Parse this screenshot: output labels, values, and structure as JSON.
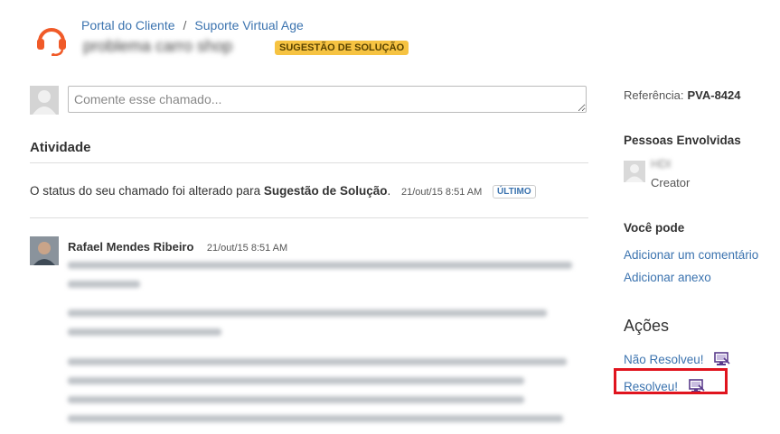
{
  "breadcrumb": {
    "items": [
      "Portal do Cliente",
      "Suporte Virtual Age"
    ],
    "separator": "/"
  },
  "ticket": {
    "title": "problema carro shop",
    "status_badge": "SUGESTÃO DE SOLUÇÃO"
  },
  "comment_box": {
    "placeholder": "Comente esse chamado..."
  },
  "activity": {
    "heading": "Atividade",
    "status_change": {
      "prefix": "O status do seu chamado foi alterado para",
      "status": "Sugestão de Solução",
      "suffix": ".",
      "date": "21/out/15 8:51 AM",
      "badge": "ÚLTIMO"
    },
    "comment": {
      "author": "Rafael Mendes Ribeiro",
      "date": "21/out/15 8:51 AM"
    }
  },
  "sidebar": {
    "reference_label": "Referência:",
    "reference_value": "PVA-8424",
    "people_heading": "Pessoas Envolvidas",
    "person_name": "HDI",
    "person_role": "Creator",
    "you_can_heading": "Você pode",
    "add_comment": "Adicionar um comentário",
    "add_attachment": "Adicionar anexo",
    "actions_heading": "Ações",
    "not_resolved": "Não Resolveu!",
    "resolved": "Resolveu!"
  },
  "colors": {
    "link": "#3b73af",
    "badge_yellow": "#f6c342",
    "highlight_red": "#e0141e",
    "icon_purple": "#5a3b8c"
  }
}
